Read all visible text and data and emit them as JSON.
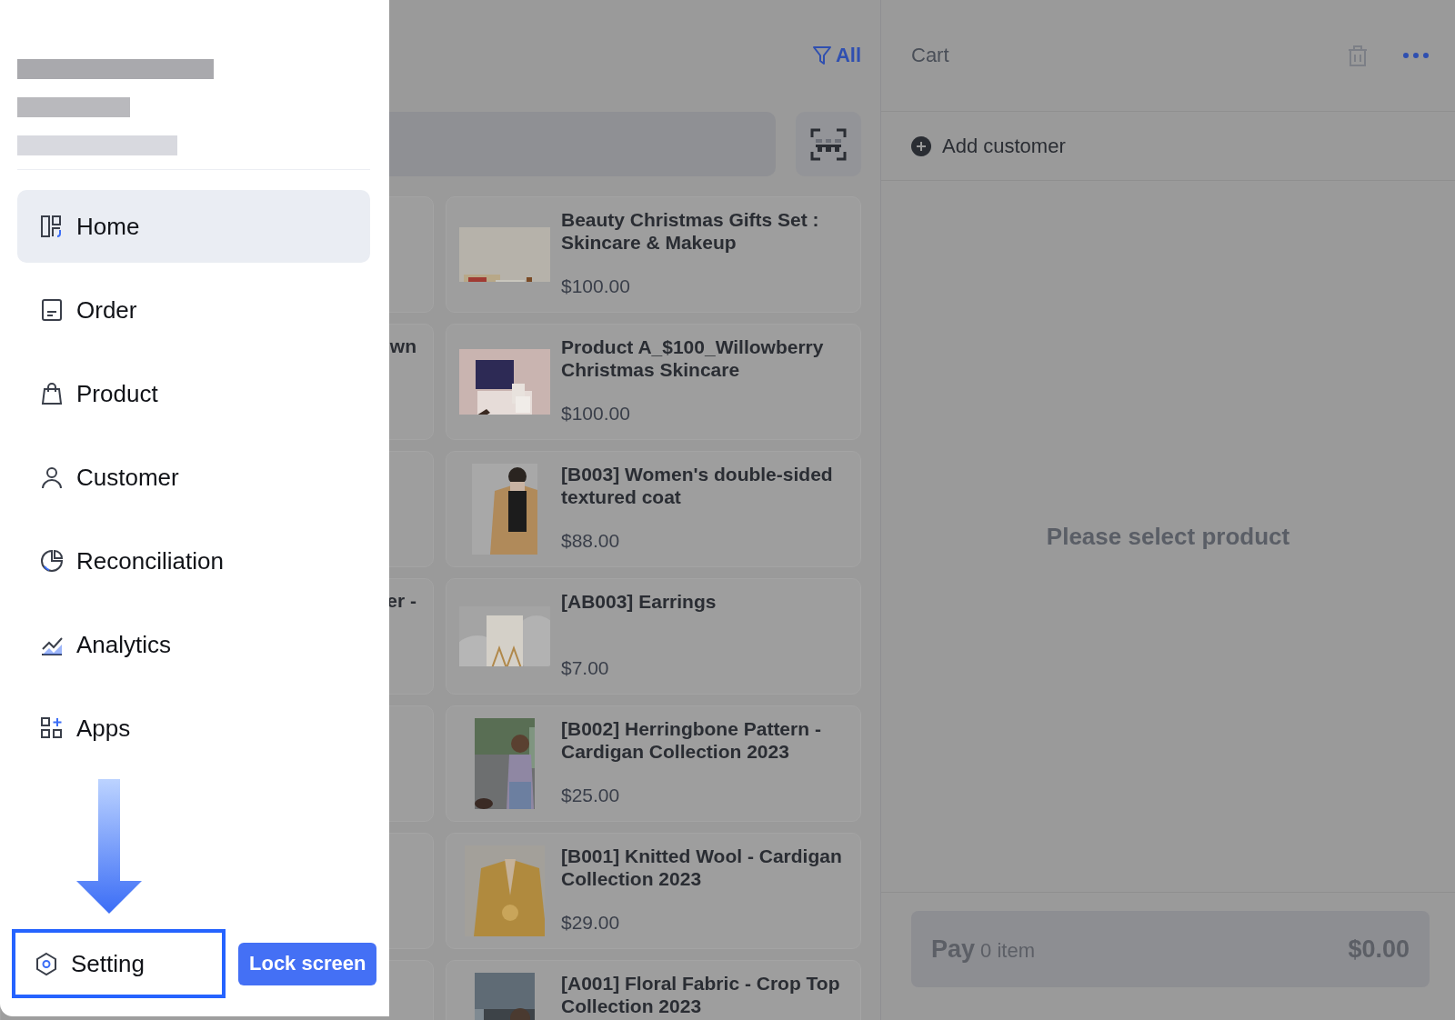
{
  "drawer": {
    "store_info": {
      "kind": "redacted"
    },
    "nav_items": [
      {
        "label": "Home",
        "selected": true
      },
      {
        "label": "Order",
        "selected": false
      },
      {
        "label": "Product",
        "selected": false
      },
      {
        "label": "Customer",
        "selected": false
      },
      {
        "label": "Reconciliation",
        "selected": false
      },
      {
        "label": "Analytics",
        "selected": false
      },
      {
        "label": "Apps",
        "selected": false
      }
    ],
    "setting": {
      "label": "Setting",
      "highlighted": true
    },
    "lock_button": "Lock screen",
    "annotation": {
      "kind": "arrow"
    }
  },
  "products": {
    "filter": "All",
    "left_cards": [
      {
        "kind": "blank"
      },
      {
        "kind": "text",
        "title": "wn"
      },
      {
        "kind": "blank"
      },
      {
        "kind": "text",
        "title": "er -"
      },
      {
        "kind": "blank"
      },
      {
        "kind": "blank"
      },
      {
        "kind": "blank"
      }
    ],
    "cards": [
      {
        "title": "Beauty Christmas Gifts Set : Skincare & Makeup",
        "price": "$100.00"
      },
      {
        "title": "Product A_$100_Willowberry Christmas Skincare",
        "price": "$100.00"
      },
      {
        "title": "[B003] Women's double-sided textured coat",
        "price": "$88.00"
      },
      {
        "title": "[AB003] Earrings",
        "price": "$7.00"
      },
      {
        "title": "[B002] Herringbone Pattern - Cardigan Collection 2023",
        "price": "$25.00"
      },
      {
        "title": "[B001] Knitted Wool - Cardigan Collection 2023",
        "price": "$29.00"
      },
      {
        "title": "[A001] Floral Fabric - Crop Top Collection 2023"
      }
    ]
  },
  "cart": {
    "title": "Cart",
    "add_customer": "Add customer",
    "empty_message": "Please select product",
    "pay": {
      "label": "Pay",
      "count": "0 item",
      "total": "$0.00",
      "disabled": true
    }
  }
}
